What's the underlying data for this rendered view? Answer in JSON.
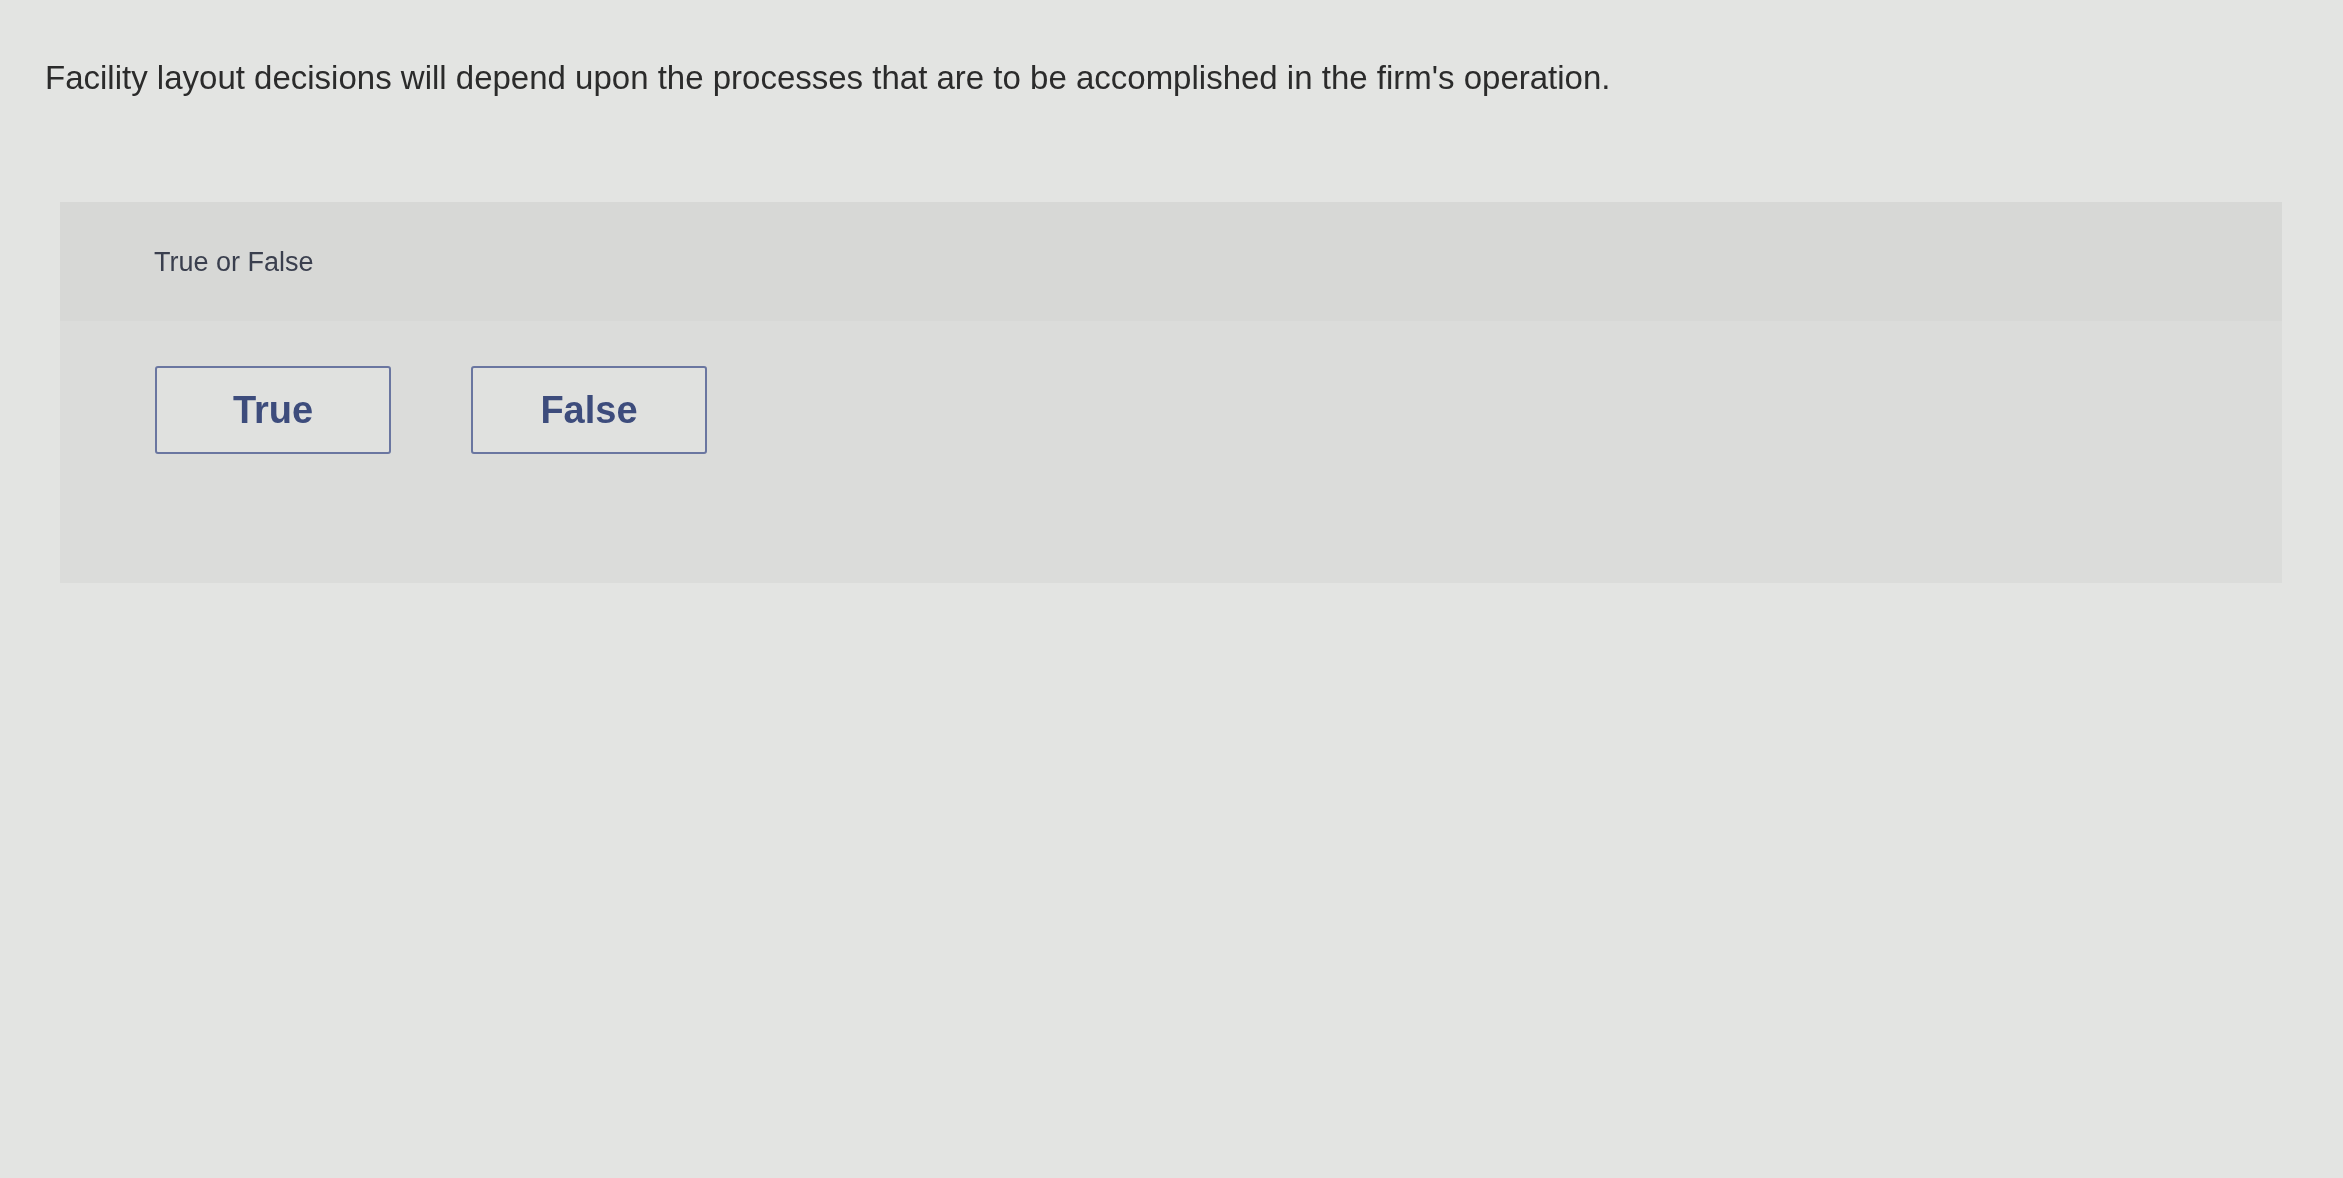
{
  "question": {
    "text": "Facility layout decisions will depend upon the processes that are to be accomplished in the firm's operation."
  },
  "panel": {
    "header": "True or False",
    "choices": [
      {
        "label": "True",
        "selected": false
      },
      {
        "label": "False",
        "selected": false
      }
    ]
  }
}
